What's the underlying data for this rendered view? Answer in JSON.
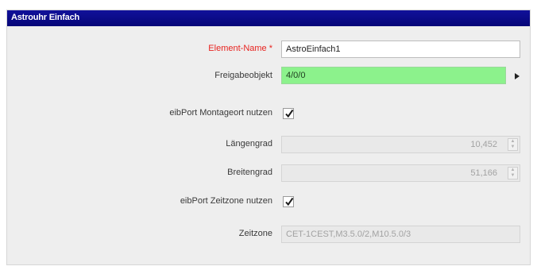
{
  "window": {
    "title": "Astrouhr Einfach"
  },
  "form": {
    "element_name": {
      "label": "Element-Name *",
      "value": "AstroEinfach1"
    },
    "freigabeobjekt": {
      "label": "Freigabeobjekt",
      "value": "4/0/0",
      "button_icon": "triangle-right-icon"
    },
    "montageort": {
      "label": "eibPort Montageort nutzen",
      "checked": true
    },
    "laengengrad": {
      "label": "Längengrad",
      "value": "10,452"
    },
    "breitengrad": {
      "label": "Breitengrad",
      "value": "51,166"
    },
    "zeitzone_nutzen": {
      "label": "eibPort Zeitzone nutzen",
      "checked": true
    },
    "zeitzone": {
      "label": "Zeitzone",
      "value": "CET-1CEST,M3.5.0/2,M10.5.0/3"
    }
  },
  "colors": {
    "title_bar": "#0a0a8c",
    "required_label": "#e8231f",
    "freigabe_field": "#8cf28c"
  }
}
